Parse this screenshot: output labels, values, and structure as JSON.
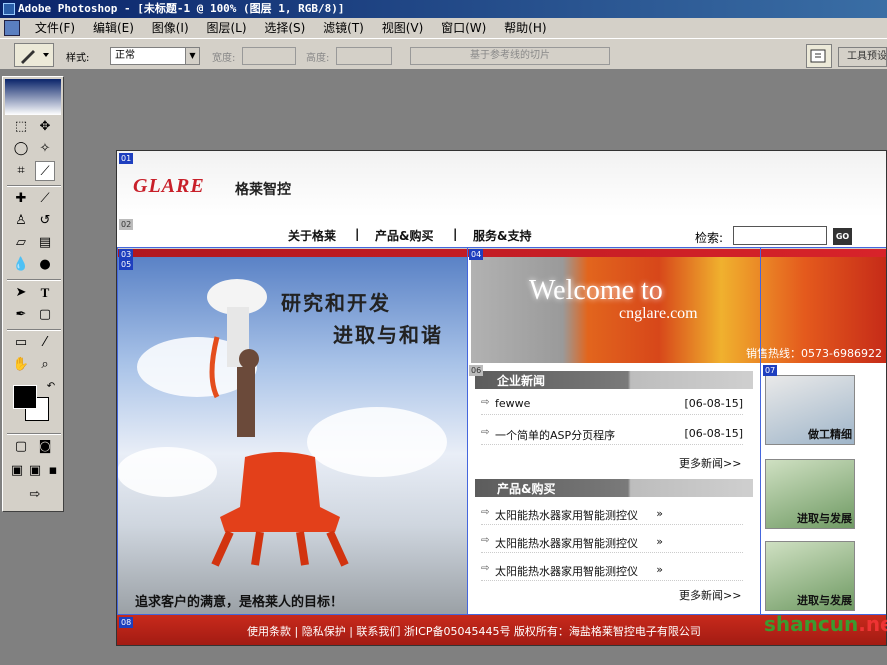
{
  "window": {
    "title": "Adobe Photoshop - [未标题-1 @ 100% (图层 1, RGB/8)]"
  },
  "menu": [
    "文件(F)",
    "编辑(E)",
    "图像(I)",
    "图层(L)",
    "选择(S)",
    "滤镜(T)",
    "视图(V)",
    "窗口(W)",
    "帮助(H)"
  ],
  "options": {
    "style_label": "样式:",
    "style_value": "正常",
    "width_label": "宽度:",
    "height_label": "高度:",
    "slices_btn": "基于参考线的切片",
    "palette_well": "工具预设"
  },
  "toolbox": {
    "tools": [
      "marquee-icon",
      "move-icon",
      "lasso-icon",
      "magic-wand-icon",
      "crop-icon",
      "slice-icon",
      "healing-icon",
      "brush-icon",
      "stamp-icon",
      "history-brush-icon",
      "eraser-icon",
      "gradient-icon",
      "blur-icon",
      "dodge-icon",
      "path-select-icon",
      "type-icon",
      "pen-icon",
      "shape-icon",
      "notes-icon",
      "eyedropper-icon",
      "hand-icon",
      "zoom-icon"
    ]
  },
  "slices": [
    "01",
    "02",
    "03",
    "04",
    "05",
    "06",
    "07",
    "08"
  ],
  "site": {
    "logo_en": "GLARE",
    "logo_cn": "格莱智控",
    "nav": [
      "关于格莱",
      "产品&购买",
      "服务&支持"
    ],
    "nav_sep": "|",
    "search_label": "检索:",
    "go_label": "GO",
    "hero_line1": "研究和开发",
    "hero_line2": "进取与和谐",
    "hero_slogan": "追求客户的满意，是格莱人的目标！",
    "welcome_line1": "Welcome to",
    "welcome_line2": "cnglare.com",
    "hotline": "销售热线：0573-6986922",
    "news_title": "企业新闻",
    "news": [
      {
        "title": "fewwe",
        "date": "[06-08-15]"
      },
      {
        "title": "一个简单的ASP分页程序",
        "date": "[06-08-15]"
      }
    ],
    "news_more": "更多新闻>>",
    "products_title": "产品&购买",
    "products": [
      "太阳能热水器家用智能测控仪",
      "太阳能热水器家用智能测控仪",
      "太阳能热水器家用智能测控仪"
    ],
    "products_more": "更多新闻>>",
    "side": [
      "做工精细",
      "进取与发展",
      "进取与发展"
    ],
    "footer": "使用条款 | 隐私保护 | 联系我们  浙ICP备05045445号  版权所有：海盐格莱智控电子有限公司"
  },
  "watermark": {
    "main": "shancun",
    "suffix": ".net"
  }
}
